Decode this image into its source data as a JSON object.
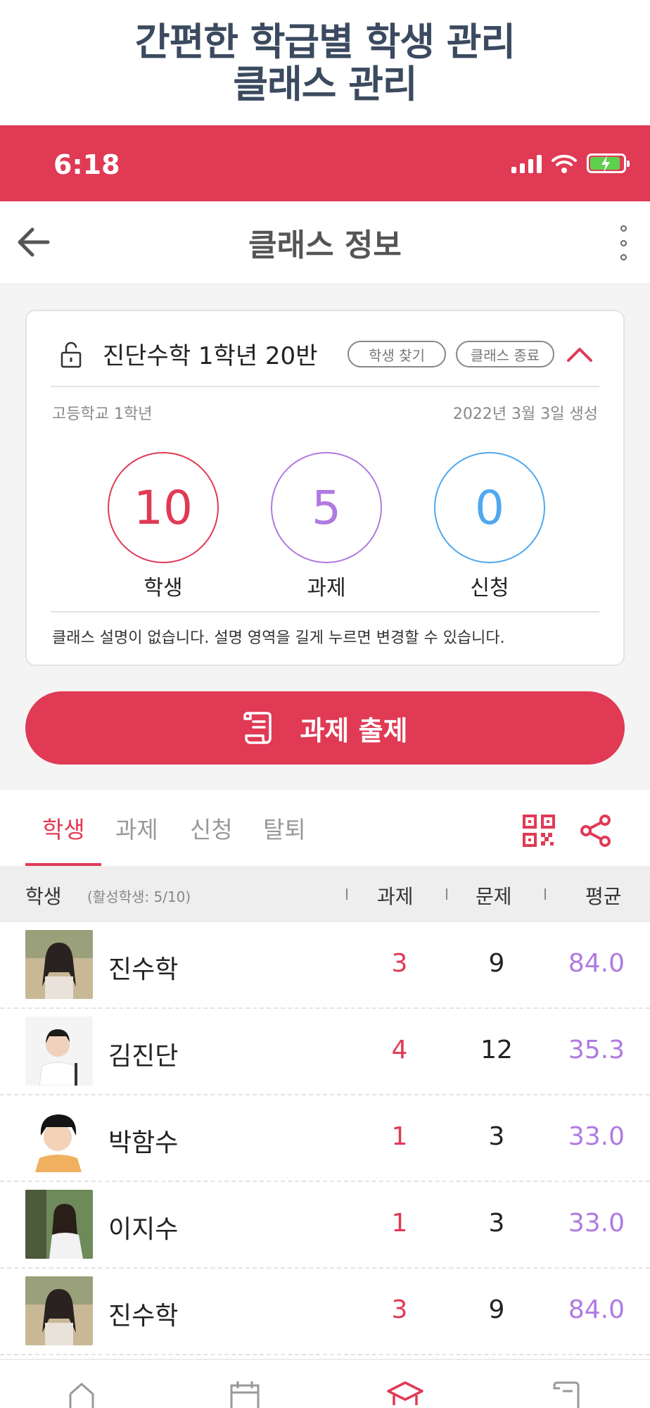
{
  "promo": {
    "line1": "간편한 학급별 학생 관리",
    "line2": "클래스 관리"
  },
  "status": {
    "time": "6:18"
  },
  "appbar": {
    "title": "클래스 정보"
  },
  "class_card": {
    "name": "진단수학 1학년 20반",
    "find_student_label": "학생 찾기",
    "end_class_label": "클래스 종료",
    "school": "고등학교 1학년",
    "created": "2022년 3월 3일 생성",
    "stats": [
      {
        "value": "10",
        "label": "학생",
        "color": "#e03a55"
      },
      {
        "value": "5",
        "label": "과제",
        "color": "#b07ae0"
      },
      {
        "value": "0",
        "label": "신청",
        "color": "#4fa8f0"
      }
    ],
    "description": "클래스 설명이 없습니다. 설명 영역을 길게 누르면 변경할 수 있습니다."
  },
  "assign_button": {
    "label": "과제 출제"
  },
  "tabs": [
    {
      "label": "학생",
      "active": true
    },
    {
      "label": "과제",
      "active": false
    },
    {
      "label": "신청",
      "active": false
    },
    {
      "label": "탈퇴",
      "active": false
    }
  ],
  "table": {
    "header_student": "학생",
    "active_count": "(활성학생: 5/10)",
    "columns": [
      "과제",
      "문제",
      "평균"
    ],
    "rows": [
      {
        "name": "진수학",
        "assignments": "3",
        "problems": "9",
        "average": "84.0"
      },
      {
        "name": "김진단",
        "assignments": "4",
        "problems": "12",
        "average": "35.3"
      },
      {
        "name": "박함수",
        "assignments": "1",
        "problems": "3",
        "average": "33.0"
      },
      {
        "name": "이지수",
        "assignments": "1",
        "problems": "3",
        "average": "33.0"
      },
      {
        "name": "진수학",
        "assignments": "3",
        "problems": "9",
        "average": "84.0"
      }
    ]
  },
  "colors": {
    "accent": "#e03a55",
    "purple": "#b07ae0",
    "blue": "#4fa8f0"
  },
  "icons": [
    "back-arrow-icon",
    "more-vertical-icon",
    "unlock-icon",
    "chevron-up-icon",
    "scroll-icon",
    "qr-code-icon",
    "share-icon",
    "home-icon",
    "calendar-icon",
    "class-icon",
    "assignment-icon"
  ]
}
